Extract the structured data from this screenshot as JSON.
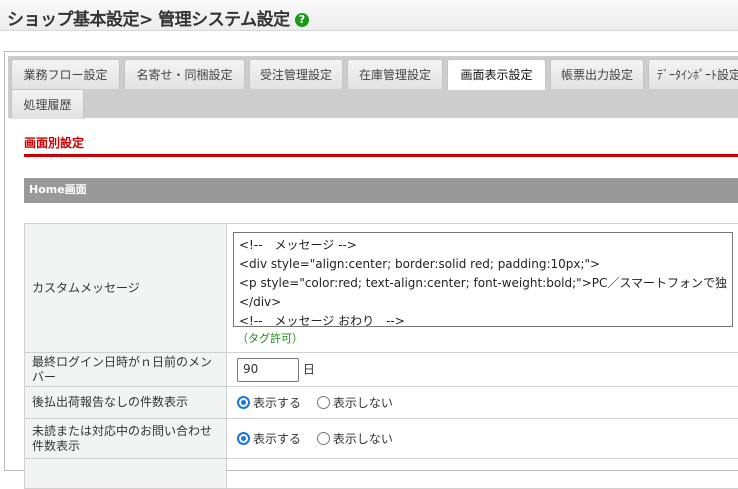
{
  "header": {
    "title": "ショップ基本設定> 管理システム設定",
    "help_icon": "?"
  },
  "tabs": [
    "業務フロー設定",
    "名寄せ・同梱設定",
    "受注管理設定",
    "在庫管理設定",
    "画面表示設定",
    "帳票出力設定",
    "ﾃﾞｰﾀｲﾝﾎﾟｰﾄ設定",
    "処理履歴"
  ],
  "active_tab": "画面表示設定",
  "section_title": "画面別設定",
  "group_title": "Home画面",
  "rows": {
    "custom_message": {
      "label": "カスタムメッセージ",
      "lines": [
        "<!--　メッセージ -->",
        "<div style=\"align:center; border:solid red; padding:10px;\">",
        "<p style=\"color:red; text-align:center; font-weight:bold;\">PC／スマートフォンで独",
        "</div>",
        "<!--　メッセージ おわり　-->"
      ],
      "note": "（タグ許可）"
    },
    "last_login": {
      "label": "最終ログイン日時がｎ日前のメンバー",
      "value": "90",
      "unit": "日"
    },
    "deferred": {
      "label": "後払出荷報告なしの件数表示",
      "options": [
        "表示する",
        "表示しない"
      ],
      "selected": "表示する"
    },
    "inquiry": {
      "label": "未読または対応中のお問い合わせ件数表示",
      "options": [
        "表示する",
        "表示しない"
      ],
      "selected": "表示する"
    }
  }
}
